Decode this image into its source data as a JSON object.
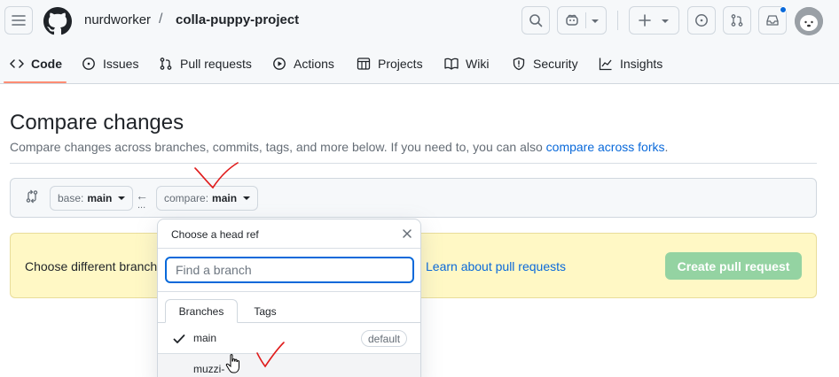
{
  "header": {
    "owner": "nurdworker",
    "separator": "/",
    "repo": "colla-puppy-project"
  },
  "nav": {
    "tabs": [
      {
        "label": "Code",
        "icon": "code-icon",
        "selected": true
      },
      {
        "label": "Issues",
        "icon": "issue-icon"
      },
      {
        "label": "Pull requests",
        "icon": "pull-request-icon"
      },
      {
        "label": "Actions",
        "icon": "play-icon"
      },
      {
        "label": "Projects",
        "icon": "table-icon"
      },
      {
        "label": "Wiki",
        "icon": "book-icon"
      },
      {
        "label": "Security",
        "icon": "shield-icon"
      },
      {
        "label": "Insights",
        "icon": "graph-icon"
      }
    ]
  },
  "main": {
    "title": "Compare changes",
    "subtitle": "Compare changes across branches, commits, tags, and more below. If you need to, you can also ",
    "subtitle_link": "compare across forks",
    "subtitle_end": ".",
    "base_prefix": "base:",
    "base_value": "main",
    "compare_prefix": "compare:",
    "compare_value": "main",
    "arrow": "←",
    "dots": "...",
    "flash_text": "Choose different branch",
    "flash_link": "Learn about pull requests",
    "create_button": "Create pull request"
  },
  "dropdown": {
    "title": "Choose a head ref",
    "search_placeholder": "Find a branch",
    "tabs": [
      "Branches",
      "Tags"
    ],
    "branches": [
      {
        "name": "main",
        "selected": true,
        "badge": "default"
      },
      {
        "name": "muzzi-"
      }
    ]
  },
  "colors": {
    "accent": "#0969da",
    "flash_bg": "#fff8c5",
    "create_disabled": "#94d3a2",
    "tab_underline": "#fd8c73",
    "annotation": "#e01b1b"
  }
}
